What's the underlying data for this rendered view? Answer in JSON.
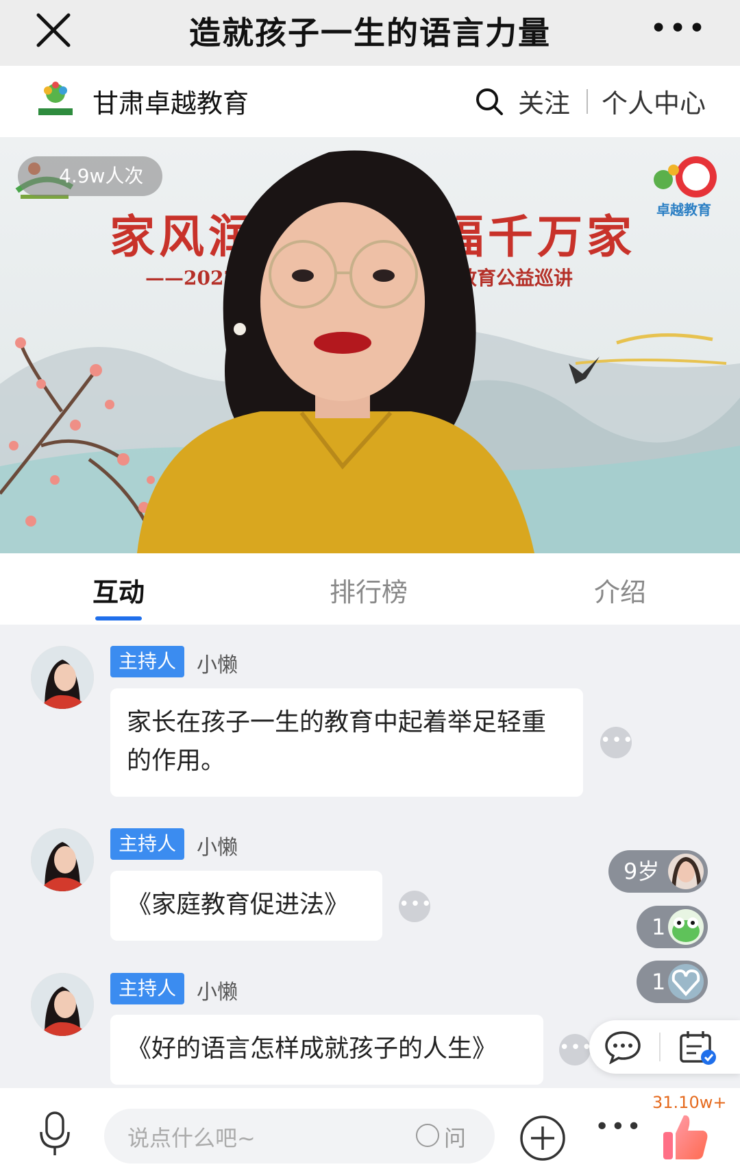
{
  "topbar": {
    "title": "造就孩子一生的语言力量",
    "more": "•••"
  },
  "channel": {
    "name": "甘肃卓越教育",
    "follow": "关注",
    "personal_center": "个人中心",
    "logo_text": "卓越教育"
  },
  "video": {
    "viewers": "4.9w人次",
    "banner_left": "家风润",
    "banner_right": "福千万家",
    "sub_left": "——2022年",
    "sub_right": "教育公益巡讲",
    "logo_right_text": "卓越教育"
  },
  "tabs": [
    {
      "label": "互动",
      "active": true
    },
    {
      "label": "排行榜",
      "active": false
    },
    {
      "label": "介绍",
      "active": false
    }
  ],
  "messages": [
    {
      "badge": "主持人",
      "user": "小懒",
      "text": "家长在孩子一生的教育中起着举足轻重的作用。"
    },
    {
      "badge": "主持人",
      "user": "小懒",
      "text": "《家庭教育促进法》"
    },
    {
      "badge": "主持人",
      "user": "小懒",
      "text": "《好的语言怎样成就孩子的人生》"
    }
  ],
  "gifts": [
    {
      "label": "9岁"
    },
    {
      "label": "1"
    },
    {
      "label": "1"
    }
  ],
  "bottom": {
    "placeholder": "说点什么吧~",
    "ask": "问",
    "likes": "31.10w+"
  },
  "colors": {
    "accent": "#1f6feb",
    "badge": "#3b8cf0",
    "likes": "#e56a1e"
  }
}
